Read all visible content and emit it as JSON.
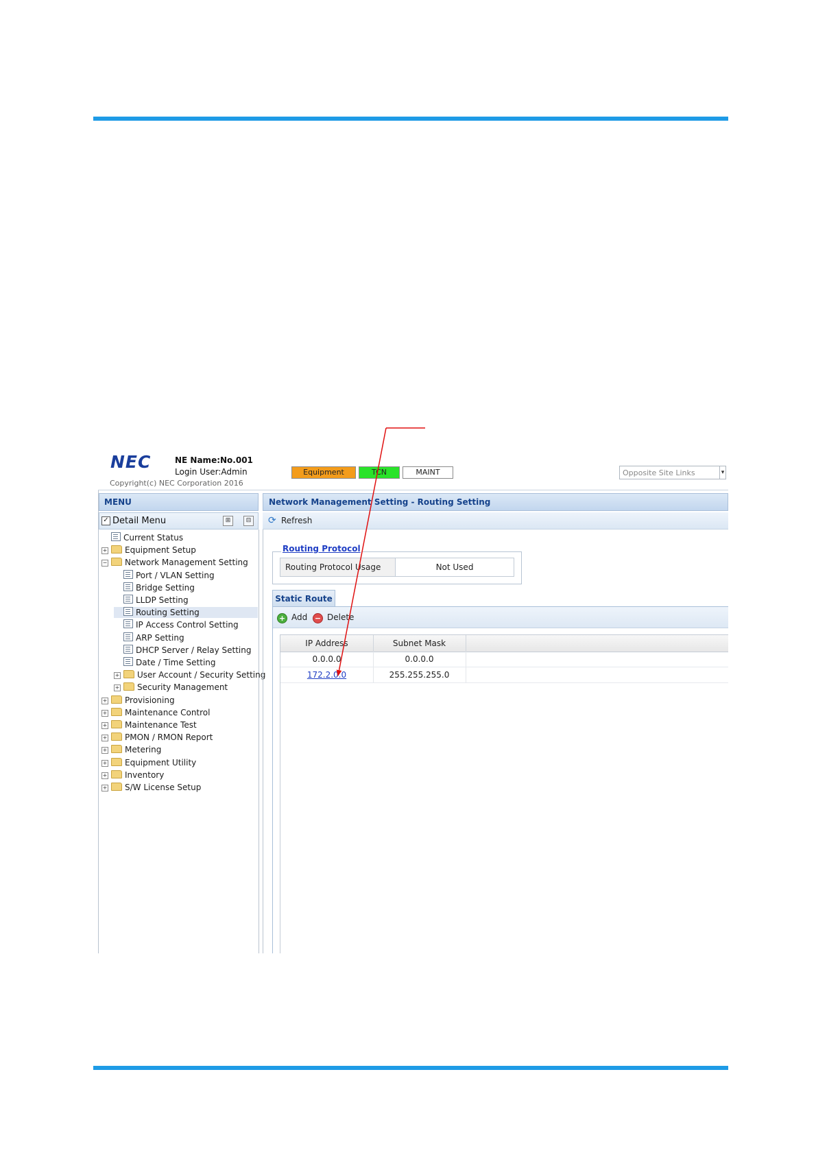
{
  "header": {
    "logo": "NEC",
    "ne_name": "NE Name:No.001",
    "login_user": "Login User:Admin",
    "copyright": "Copyright(c) NEC Corporation 2016",
    "status": {
      "equipment": "Equipment",
      "tcn": "TCN",
      "maint": "MAINT"
    },
    "opposite_site_links": "Opposite Site Links",
    "colors": {
      "equipment": "#f39c1b",
      "tcn": "#2ae32a",
      "rule": "#1e9be6"
    }
  },
  "menu": {
    "title": "MENU",
    "detail_menu": "Detail Menu",
    "items": [
      {
        "label": "Current Status",
        "level": 0,
        "kind": "doc",
        "expander": "none"
      },
      {
        "label": "Equipment Setup",
        "level": 0,
        "kind": "folder",
        "expander": "plus"
      },
      {
        "label": "Network Management Setting",
        "level": 0,
        "kind": "folder",
        "expander": "minus"
      },
      {
        "label": "Port / VLAN Setting",
        "level": 1,
        "kind": "doc",
        "expander": "none"
      },
      {
        "label": "Bridge Setting",
        "level": 1,
        "kind": "doc",
        "expander": "none"
      },
      {
        "label": "LLDP Setting",
        "level": 1,
        "kind": "doc",
        "expander": "none"
      },
      {
        "label": "Routing Setting",
        "level": 1,
        "kind": "doc",
        "expander": "none",
        "selected": true
      },
      {
        "label": "IP Access Control Setting",
        "level": 1,
        "kind": "doc",
        "expander": "none"
      },
      {
        "label": "ARP Setting",
        "level": 1,
        "kind": "doc",
        "expander": "none"
      },
      {
        "label": "DHCP Server / Relay Setting",
        "level": 1,
        "kind": "doc",
        "expander": "none"
      },
      {
        "label": "Date / Time Setting",
        "level": 1,
        "kind": "doc",
        "expander": "none"
      },
      {
        "label": "User Account / Security Setting",
        "level": 1,
        "kind": "folder",
        "expander": "plus"
      },
      {
        "label": "Security Management",
        "level": 1,
        "kind": "folder",
        "expander": "plus"
      },
      {
        "label": "Provisioning",
        "level": 0,
        "kind": "folder",
        "expander": "plus"
      },
      {
        "label": "Maintenance Control",
        "level": 0,
        "kind": "folder",
        "expander": "plus"
      },
      {
        "label": "Maintenance Test",
        "level": 0,
        "kind": "folder",
        "expander": "plus"
      },
      {
        "label": "PMON / RMON Report",
        "level": 0,
        "kind": "folder",
        "expander": "plus"
      },
      {
        "label": "Metering",
        "level": 0,
        "kind": "folder",
        "expander": "plus"
      },
      {
        "label": "Equipment Utility",
        "level": 0,
        "kind": "folder",
        "expander": "plus"
      },
      {
        "label": "Inventory",
        "level": 0,
        "kind": "folder",
        "expander": "plus"
      },
      {
        "label": "S/W License Setup",
        "level": 0,
        "kind": "folder",
        "expander": "plus"
      }
    ]
  },
  "main": {
    "title": "Network Management Setting - Routing Setting",
    "refresh": "Refresh",
    "routing_protocol": {
      "title": "Routing Protocol",
      "label": "Routing Protocol Usage",
      "value": "Not Used"
    },
    "static_route": {
      "tab": "Static Route",
      "add": "Add",
      "delete": "Delete",
      "columns": [
        "IP Address",
        "Subnet Mask"
      ],
      "rows": [
        {
          "ip": "0.0.0.0",
          "mask": "0.0.0.0",
          "link": false
        },
        {
          "ip": "172.2.0.0",
          "mask": "255.255.255.0",
          "link": true
        }
      ]
    }
  }
}
